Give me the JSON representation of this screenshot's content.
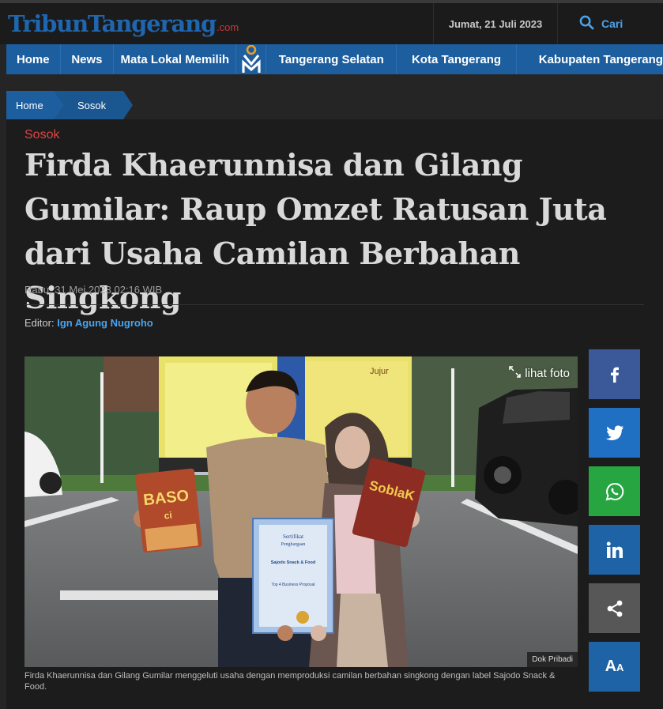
{
  "header": {
    "logo_text": "TribunTangerang",
    "logo_suffix": ".com",
    "date": "Jumat, 21 Juli 2023",
    "search_label": "Cari"
  },
  "nav": {
    "items": [
      "Home",
      "News",
      "Mata Lokal Memilih",
      "Tangerang Selatan",
      "Kota Tangerang",
      "Kabupaten Tangerang"
    ]
  },
  "breadcrumb": {
    "home": "Home",
    "section": "Sosok"
  },
  "article": {
    "section": "Sosok",
    "title": "Firda Khaerunnisa dan Gilang Gumilar: Raup Omzet Ratusan Juta dari Usaha Camilan Berbahan Singkong",
    "published": "Rabu, 31 Mei 2023 02:16 WIB",
    "editor_label": "Editor:",
    "editor_name": "Ign Agung Nugroho",
    "photo_view_label": "lihat foto",
    "photo_credit": "Dok Pribadi",
    "photo_caption": "Firda Khaerunnisa dan Gilang Gumilar menggeluti usaha dengan memproduksi camilan berbahan singkong dengan label Sajodo Snack & Food.",
    "photo_text": {
      "package_left": "BASO",
      "package_left_sub": "ci",
      "package_right": "SoblaK",
      "certificate_title": "Sertifikat",
      "certificate_subtitle": "Penghargaan",
      "certificate_name": "Sajodo Snack & Food",
      "certificate_award": "Top 4 Business Proposal",
      "board_word": "Jujur"
    }
  },
  "share": {
    "buttons": [
      {
        "name": "facebook",
        "color": "#3b5998"
      },
      {
        "name": "twitter",
        "color": "#1f6fc2"
      },
      {
        "name": "whatsapp",
        "color": "#26a541"
      },
      {
        "name": "linkedin",
        "color": "#1e63a6"
      },
      {
        "name": "share",
        "color": "#575757"
      },
      {
        "name": "font-size",
        "color": "#1e63a6"
      }
    ]
  },
  "colors": {
    "brand_blue": "#1d5e9f",
    "accent_red": "#e34444",
    "link_blue": "#4aa3ec",
    "bg": "#1c1c1c"
  }
}
